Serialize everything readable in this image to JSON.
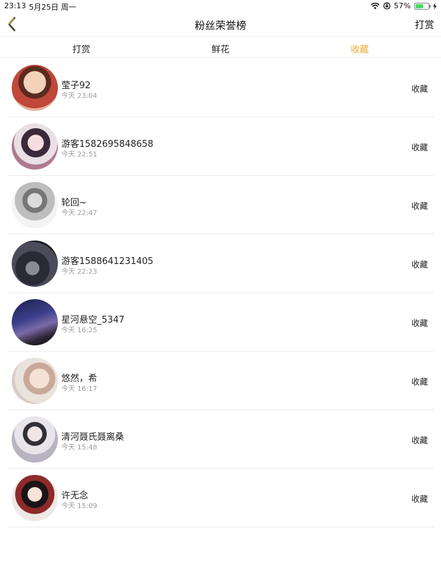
{
  "status_bar": {
    "time": "23:13",
    "date": "5月25日 周一",
    "battery": "57%"
  },
  "nav": {
    "title": "粉丝荣誉榜",
    "right_action": "打赏"
  },
  "tabs": [
    {
      "label": "打赏",
      "active": false
    },
    {
      "label": "鲜花",
      "active": false
    },
    {
      "label": "收藏",
      "active": true
    }
  ],
  "accent_color": "#f0a92e",
  "list": [
    {
      "name": "莹子92",
      "time": "今天 23:04",
      "action": "收藏"
    },
    {
      "name": "游客1582695848658",
      "time": "今天 22:51",
      "action": "收藏"
    },
    {
      "name": "轮回~",
      "time": "今天 22:47",
      "action": "收藏"
    },
    {
      "name": "游客1588641231405",
      "time": "今天 22:23",
      "action": "收藏"
    },
    {
      "name": "星河悬空_5347",
      "time": "今天 16:25",
      "action": "收藏"
    },
    {
      "name": "悠然，希",
      "time": "今天 16:17",
      "action": "收藏"
    },
    {
      "name": "清河聂氏聂离桑",
      "time": "今天 15:48",
      "action": "收藏"
    },
    {
      "name": "许无念",
      "time": "今天 15:09",
      "action": "收藏"
    }
  ]
}
